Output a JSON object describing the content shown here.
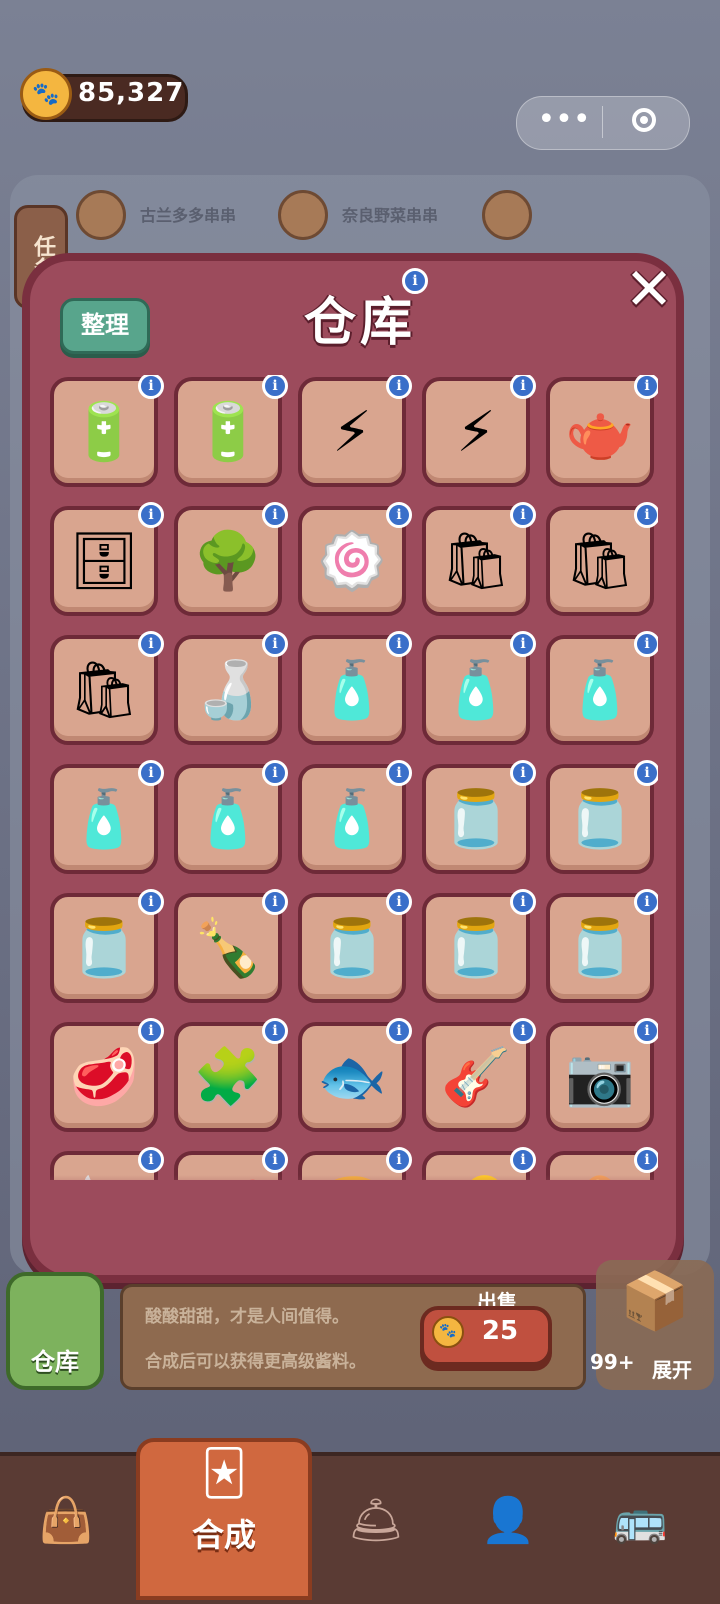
{
  "coins": {
    "value": "85,327",
    "icon": "paw-coin-icon"
  },
  "background": {
    "task_tab": "任务",
    "orders": [
      {
        "label": "古兰多多串串"
      },
      {
        "label": "奈良野菜串串"
      }
    ]
  },
  "warehouse": {
    "title": "仓库",
    "sort_label": "整理",
    "close_label": "✕",
    "info_symbol": "i",
    "items": [
      {
        "name": "small-battery",
        "glyph": "🔋"
      },
      {
        "name": "battery",
        "glyph": "🔋"
      },
      {
        "name": "energy-box",
        "glyph": "⚡"
      },
      {
        "name": "energy-box",
        "glyph": "⚡"
      },
      {
        "name": "teapot",
        "glyph": "🫖"
      },
      {
        "name": "cabinet",
        "glyph": "🗄"
      },
      {
        "name": "flower-tree",
        "glyph": "🌳"
      },
      {
        "name": "pink-ball",
        "glyph": "🍥"
      },
      {
        "name": "ck-bag",
        "glyph": "🛍"
      },
      {
        "name": "ck-bag",
        "glyph": "🛍"
      },
      {
        "name": "ck-bag",
        "glyph": "🛍"
      },
      {
        "name": "sauce-bottle",
        "glyph": "🍶"
      },
      {
        "name": "sauce-triangle",
        "glyph": "🧴"
      },
      {
        "name": "sauce-triangle",
        "glyph": "🧴"
      },
      {
        "name": "sauce-triangle",
        "glyph": "🧴"
      },
      {
        "name": "sauce-triangle",
        "glyph": "🧴"
      },
      {
        "name": "sauce-triangle",
        "glyph": "🧴"
      },
      {
        "name": "sauce-triangle",
        "glyph": "🧴"
      },
      {
        "name": "red-jar",
        "glyph": "🫙"
      },
      {
        "name": "red-jar",
        "glyph": "🫙"
      },
      {
        "name": "red-jar",
        "glyph": "🫙"
      },
      {
        "name": "brown-bottle",
        "glyph": "🍾"
      },
      {
        "name": "fish-jar",
        "glyph": "🫙"
      },
      {
        "name": "fish-jar",
        "glyph": "🫙"
      },
      {
        "name": "fish-jar",
        "glyph": "🫙"
      },
      {
        "name": "meat-plate",
        "glyph": "🥩"
      },
      {
        "name": "puzzle-picture",
        "glyph": "🧩"
      },
      {
        "name": "fish-statue",
        "glyph": "🐟"
      },
      {
        "name": "guitar",
        "glyph": "🎸"
      },
      {
        "name": "camera",
        "glyph": "📷"
      },
      {
        "name": "partial-item",
        "glyph": "🍬"
      },
      {
        "name": "partial-item",
        "glyph": "🎀"
      },
      {
        "name": "partial-item",
        "glyph": "🍞"
      },
      {
        "name": "partial-item",
        "glyph": "🔑"
      },
      {
        "name": "partial-item",
        "glyph": "🥚"
      }
    ]
  },
  "detail": {
    "line1": "酸酸甜甜，才是人间值得。",
    "line2": "合成后可以获得更高级酱料。",
    "sell_label": "出售",
    "sell_price": "25"
  },
  "store": {
    "label": "仓库"
  },
  "side_box": {
    "count": "99+",
    "expand": "展开"
  },
  "nav": {
    "active_label": "合成",
    "items": [
      {
        "name": "bag-icon",
        "glyph": "👜"
      },
      {
        "name": "cloche-icon",
        "glyph": "🛎"
      },
      {
        "name": "profile-icon",
        "glyph": "👤"
      },
      {
        "name": "bus-icon",
        "glyph": "🚌"
      }
    ]
  }
}
